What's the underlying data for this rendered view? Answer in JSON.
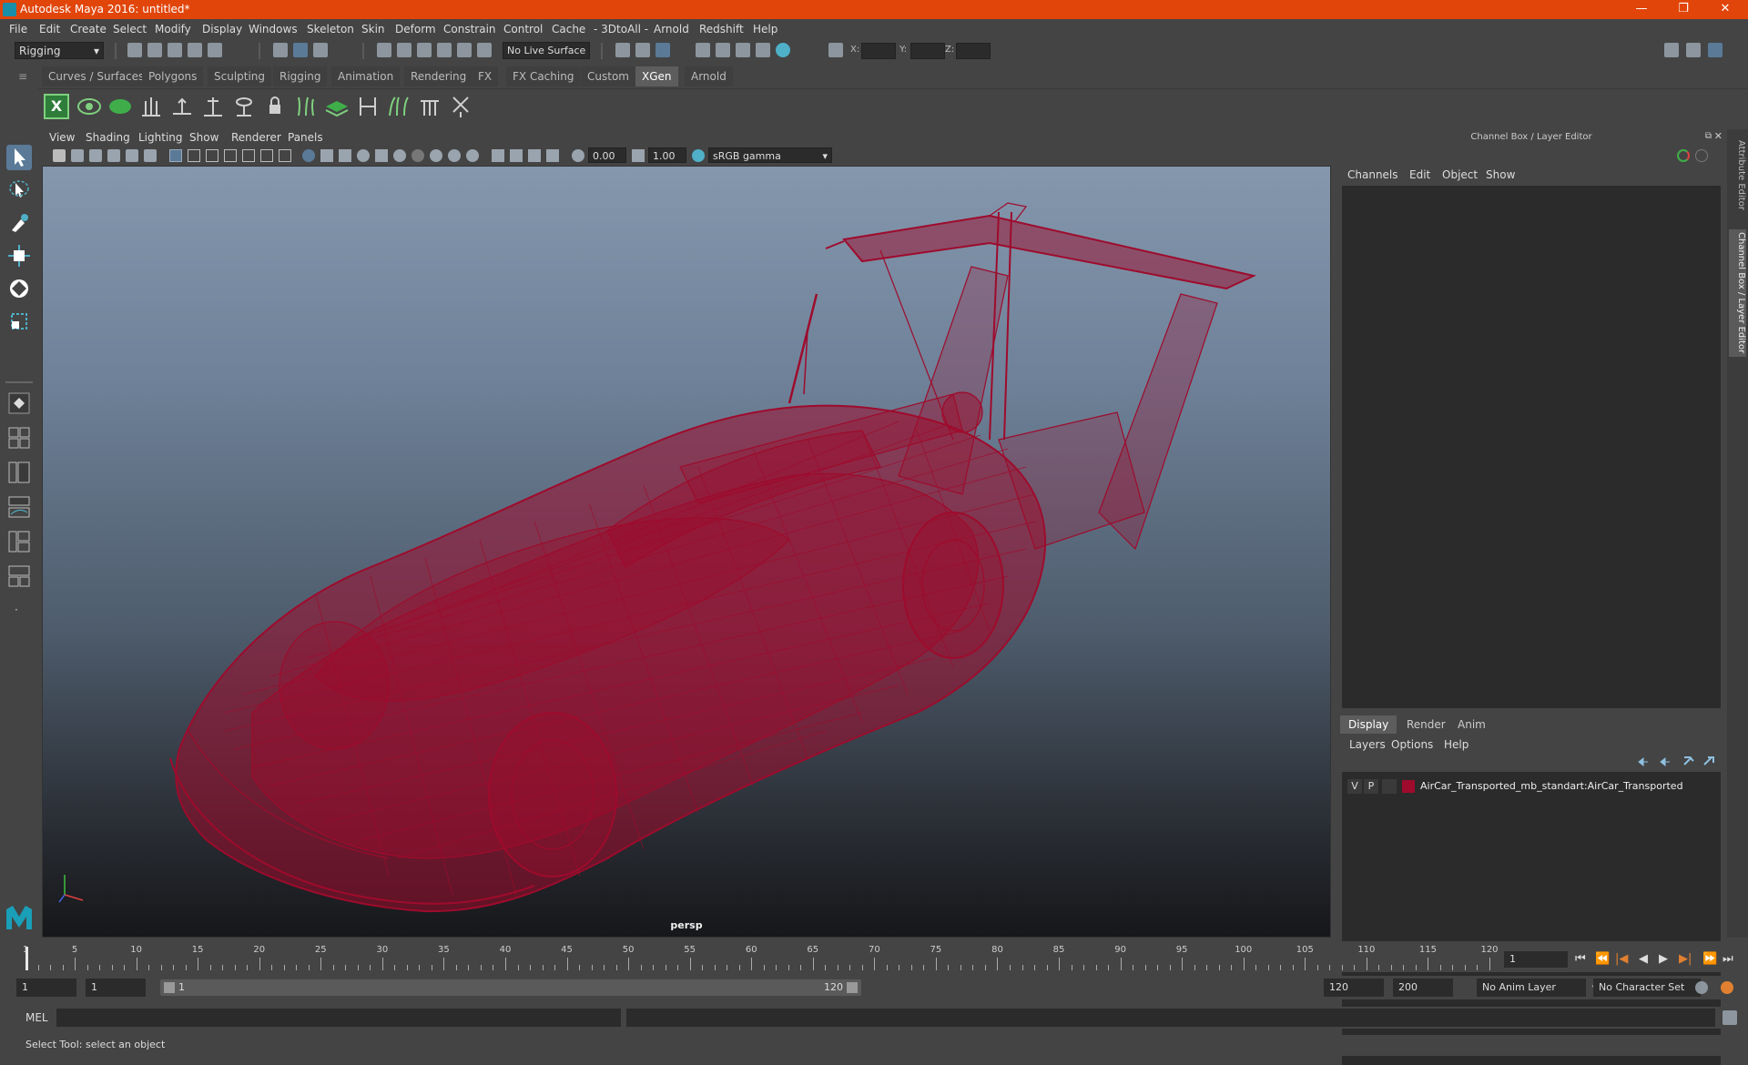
{
  "window": {
    "title": "Autodesk Maya 2016: untitled*",
    "controls": [
      "—",
      "❐",
      "✕"
    ]
  },
  "menubar": [
    "File",
    "Edit",
    "Create",
    "Select",
    "Modify",
    "Display",
    "Windows",
    "Skeleton",
    "Skin",
    "Deform",
    "Constrain",
    "Control",
    "Cache",
    "- 3DtoAll -",
    "Arnold",
    "Redshift",
    "Help"
  ],
  "statusline": {
    "menu_set": "Rigging",
    "live_surface": "No Live Surface",
    "x_label": "X:",
    "y_label": "Y:",
    "z_label": "Z:"
  },
  "shelf": {
    "tabs": [
      "Curves / Surfaces",
      "Polygons",
      "Sculpting",
      "Rigging",
      "Animation",
      "Rendering",
      "FX",
      "FX Caching",
      "Custom",
      "XGen",
      "Arnold"
    ],
    "active_tab": "XGen"
  },
  "viewport": {
    "menus": [
      "View",
      "Shading",
      "Lighting",
      "Show",
      "Renderer",
      "Panels"
    ],
    "exposure": "0.00",
    "gamma": "1.00",
    "color_space": "sRGB gamma",
    "camera_label": "persp",
    "wire_color": "#9e0b2c"
  },
  "channelbox": {
    "header": "Channel Box / Layer Editor",
    "menus": [
      "Channels",
      "Edit",
      "Object",
      "Show"
    ]
  },
  "layer_editor": {
    "tabs": [
      "Display",
      "Render",
      "Anim"
    ],
    "active_tab": "Display",
    "menus": [
      "Layers",
      "Options",
      "Help"
    ],
    "layers": [
      {
        "visible": "V",
        "playback": "P",
        "color": "#9e0b2c",
        "name": "AirCar_Transported_mb_standart:AirCar_Transported"
      }
    ]
  },
  "side_tabs": [
    "Attribute Editor",
    "Channel Box / Layer Editor"
  ],
  "timeline": {
    "ticks": [
      "1",
      "5",
      "10",
      "15",
      "20",
      "25",
      "30",
      "35",
      "40",
      "45",
      "50",
      "55",
      "60",
      "65",
      "70",
      "75",
      "80",
      "85",
      "90",
      "95",
      "100",
      "105",
      "110",
      "115",
      "120"
    ],
    "current_frame": "1",
    "playback_buttons": [
      "⏮",
      "⏪",
      "|◀",
      "◀",
      "▶",
      "▶|",
      "⏩",
      "⏭"
    ]
  },
  "range": {
    "start": "1",
    "playback_start": "1",
    "slider_start": "1",
    "slider_end": "120",
    "playback_end": "120",
    "end": "200",
    "anim_layer": "No Anim Layer",
    "character_set": "No Character Set"
  },
  "cmdline": {
    "label": "MEL"
  },
  "helpline": {
    "text": "Select Tool: select an object"
  }
}
